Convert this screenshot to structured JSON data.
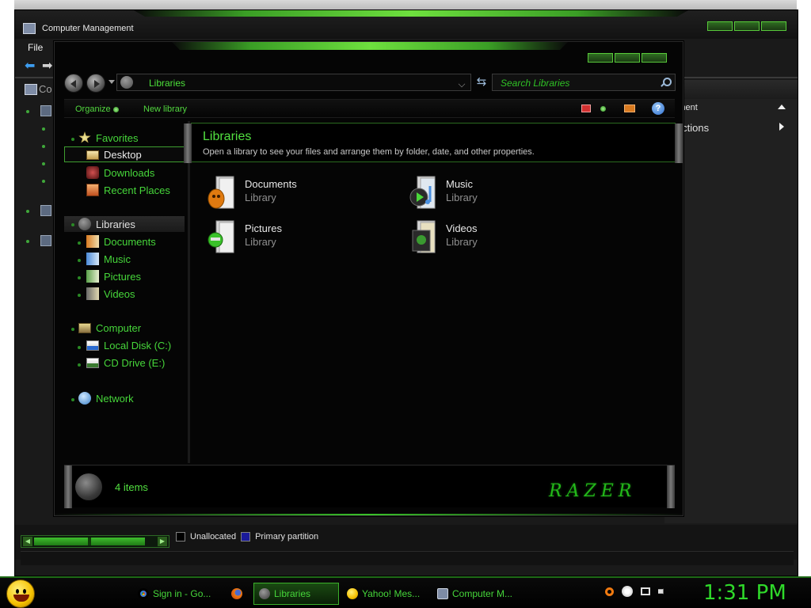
{
  "computer_management": {
    "title": "Computer Management",
    "menu": {
      "file": "File"
    },
    "tree_root_label": "Co",
    "actions": {
      "header_item": "agement",
      "more_actions": "re Actions"
    },
    "legend": {
      "unallocated": "Unallocated",
      "primary_partition": "Primary partition",
      "unallocated_color": "#000000",
      "primary_color": "#1a1a9a"
    }
  },
  "libraries_window": {
    "address": "Libraries",
    "search_placeholder": "Search Libraries",
    "commands": {
      "organize": "Organize",
      "new_library": "New library"
    },
    "nav": {
      "favorites": "Favorites",
      "desktop": "Desktop",
      "downloads": "Downloads",
      "recent_places": "Recent Places",
      "libraries": "Libraries",
      "documents": "Documents",
      "music": "Music",
      "pictures": "Pictures",
      "videos": "Videos",
      "computer": "Computer",
      "local_disk": "Local Disk (C:)",
      "cd_drive": "CD Drive (E:)",
      "network": "Network"
    },
    "content": {
      "title": "Libraries",
      "subtitle": "Open a library to see your files and arrange them by folder, date, and other properties.",
      "items": [
        {
          "name": "Documents",
          "type": "Library",
          "icon": "documents-library-icon"
        },
        {
          "name": "Music",
          "type": "Library",
          "icon": "music-library-icon"
        },
        {
          "name": "Pictures",
          "type": "Library",
          "icon": "pictures-library-icon"
        },
        {
          "name": "Videos",
          "type": "Library",
          "icon": "videos-library-icon"
        }
      ]
    },
    "status": {
      "item_count": "4 items",
      "logo": "RAZER"
    }
  },
  "taskbar": {
    "tasks": [
      {
        "label": "Sign in - Go...",
        "icon": "chrome-icon"
      },
      {
        "label": "",
        "icon": "firefox-icon"
      },
      {
        "label": "Libraries",
        "icon": "libraries-icon"
      },
      {
        "label": "Yahoo! Mes...",
        "icon": "yahoo-messenger-icon"
      },
      {
        "label": "Computer M...",
        "icon": "computer-management-icon"
      }
    ],
    "clock": "1:31 PM"
  },
  "colors": {
    "accent_green": "#46d63a",
    "window_bg": "#050505"
  }
}
